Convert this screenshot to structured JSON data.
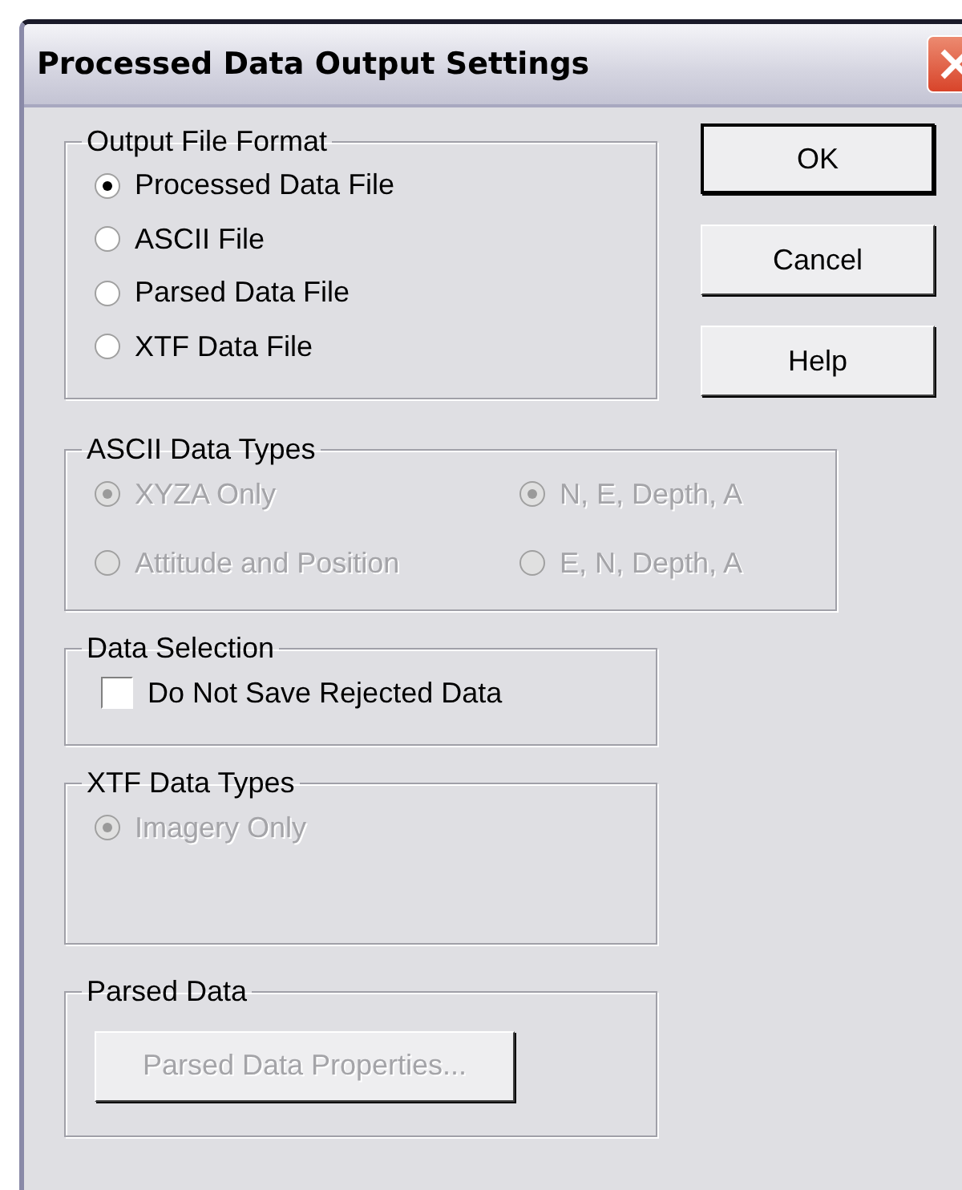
{
  "window": {
    "title": "Processed Data Output Settings"
  },
  "groups": [
    {
      "title": "Output File Format",
      "kind": "radio",
      "disabled": false,
      "options": [
        {
          "label": "Processed Data File",
          "selected": true
        },
        {
          "label": "ASCII File",
          "selected": false
        },
        {
          "label": "Parsed Data File",
          "selected": false
        },
        {
          "label": "XTF Data File",
          "selected": false
        }
      ]
    },
    {
      "title": "ASCII Data Types",
      "kind": "radio",
      "disabled": true,
      "options": [
        {
          "label": "XYZA Only",
          "selected": true
        },
        {
          "label": "N, E, Depth, A",
          "selected": true
        },
        {
          "label": "Attitude and Position",
          "selected": false
        },
        {
          "label": "E, N, Depth, A",
          "selected": false
        }
      ]
    },
    {
      "title": "Data Selection",
      "kind": "checkbox",
      "disabled": false,
      "options": [
        {
          "label": "Do Not Save Rejected Data",
          "checked": false
        }
      ]
    },
    {
      "title": "XTF Data Types",
      "kind": "radio",
      "disabled": true,
      "options": [
        {
          "label": "Imagery Only",
          "selected": true
        }
      ]
    },
    {
      "title": "Parsed Data",
      "kind": "button",
      "disabled": true,
      "options": [
        {
          "label": "Parsed Data Properties..."
        }
      ]
    }
  ],
  "buttons": [
    "OK",
    "Cancel",
    "Help"
  ]
}
